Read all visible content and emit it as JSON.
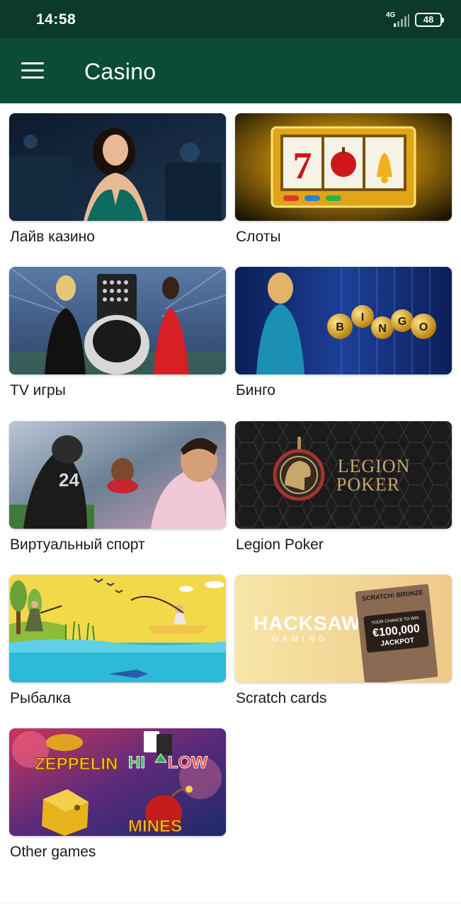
{
  "status_bar": {
    "time": "14:58",
    "network": "4G",
    "battery": "48"
  },
  "header": {
    "title": "Casino",
    "menu_icon": "hamburger-menu-icon"
  },
  "tiles": [
    {
      "label": "Лайв казино"
    },
    {
      "label": "Слоты",
      "image_text": "7"
    },
    {
      "label": "TV игры"
    },
    {
      "label": "Бинго",
      "image_text": [
        "B",
        "I",
        "N",
        "G",
        "O"
      ]
    },
    {
      "label": "Виртуальный спорт",
      "image_text": "24"
    },
    {
      "label": "Legion Poker",
      "image_text": [
        "LEGION",
        "POKER"
      ]
    },
    {
      "label": "Рыбалка"
    },
    {
      "label": "Scratch cards",
      "image_text": [
        "HACKSAW",
        "GAMING",
        "SCRATCH! BRONZE",
        "YOUR CHANCE TO WIN",
        "€100,000",
        "JACKPOT"
      ]
    },
    {
      "label": "Other games",
      "image_text": [
        "ZEPPELIN",
        "HI",
        "LOW",
        "MINES"
      ]
    }
  ],
  "colors": {
    "status_bar": "#0b3a2a",
    "app_bar": "#0b4c35",
    "label_text": "#1a1a1a"
  }
}
